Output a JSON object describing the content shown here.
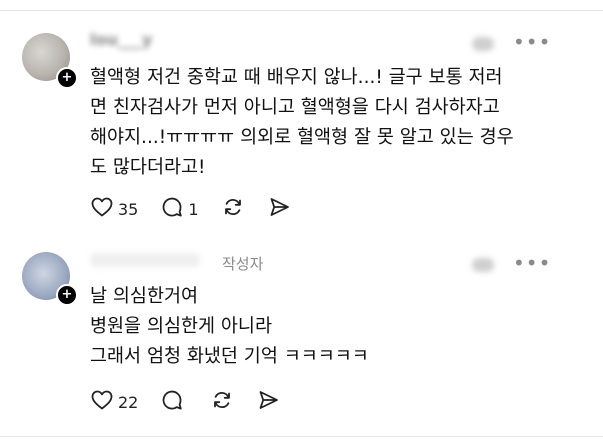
{
  "comments": [
    {
      "username": "lou___y",
      "author_tag": "",
      "lines": [
        "혈액형 저건 중학교 때 배우지 않나...! 글구 보통 저러",
        "면 친자검사가 먼저 아니고 혈액형을 다시 검사하자고",
        "해야지...!ㅠㅠㅠㅠ 의외로 혈액형 잘 못 알고 있는 경우",
        "도 많다더라고!"
      ],
      "likes": "35",
      "replies": "1",
      "more_label": "•••"
    },
    {
      "username": "",
      "author_tag": "작성자",
      "lines": [
        "날 의심한거여",
        "병원을 의심한게 아니라",
        "그래서 엄청 화냈던 기억 ㅋㅋㅋㅋㅋ"
      ],
      "likes": "22",
      "replies": "",
      "more_label": "•••"
    }
  ],
  "badge_plus": "+",
  "icons": [
    "heart-icon",
    "comment-icon",
    "repost-icon",
    "share-icon"
  ]
}
